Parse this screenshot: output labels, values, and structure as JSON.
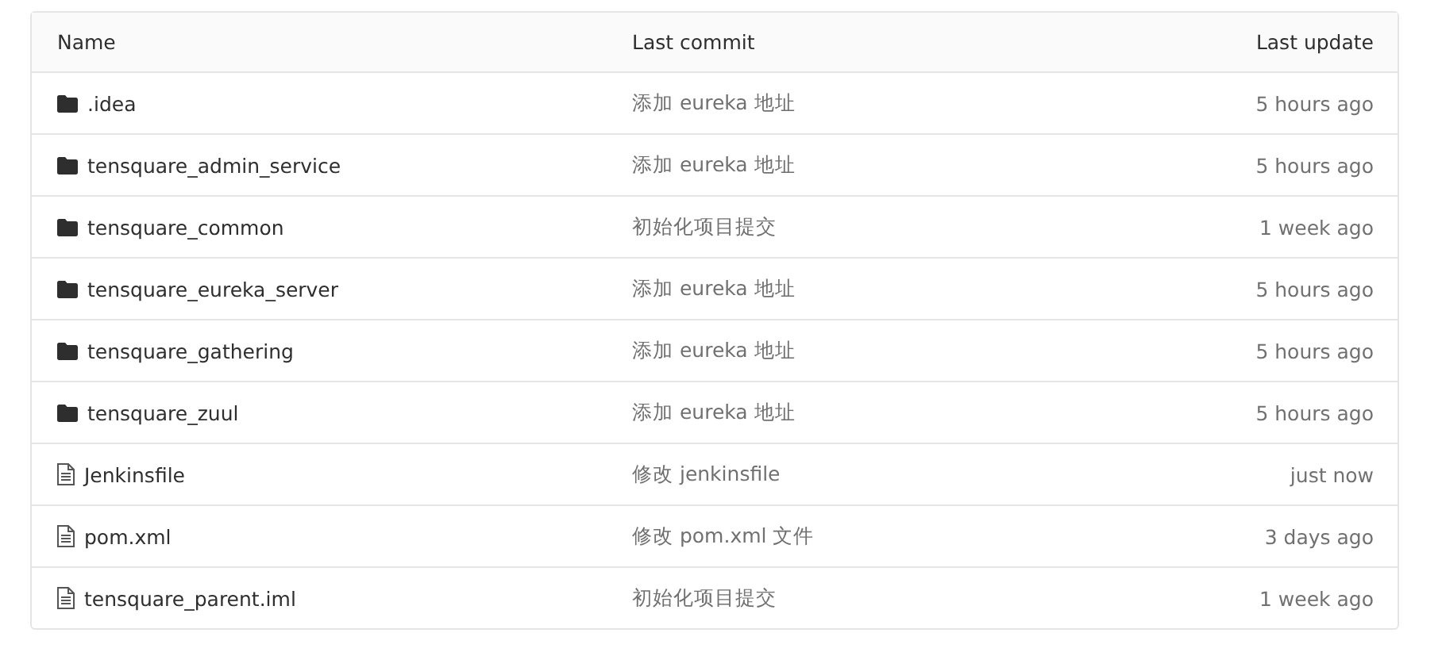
{
  "table": {
    "columns": [
      "Name",
      "Last commit",
      "Last update"
    ],
    "rows": [
      {
        "kind": "folder",
        "name": ".idea",
        "commit": "添加 eureka 地址",
        "updated": "5 hours ago"
      },
      {
        "kind": "folder",
        "name": "tensquare_admin_service",
        "commit": "添加 eureka 地址",
        "updated": "5 hours ago"
      },
      {
        "kind": "folder",
        "name": "tensquare_common",
        "commit": "初始化项目提交",
        "updated": "1 week ago"
      },
      {
        "kind": "folder",
        "name": "tensquare_eureka_server",
        "commit": "添加 eureka 地址",
        "updated": "5 hours ago"
      },
      {
        "kind": "folder",
        "name": "tensquare_gathering",
        "commit": "添加 eureka 地址",
        "updated": "5 hours ago"
      },
      {
        "kind": "folder",
        "name": "tensquare_zuul",
        "commit": "添加 eureka 地址",
        "updated": "5 hours ago"
      },
      {
        "kind": "file",
        "name": "Jenkinsfile",
        "commit": "修改 jenkinsfile",
        "updated": "just now"
      },
      {
        "kind": "file",
        "name": "pom.xml",
        "commit": "修改 pom.xml 文件",
        "updated": "3 days ago"
      },
      {
        "kind": "file",
        "name": "tensquare_parent.iml",
        "commit": "初始化项目提交",
        "updated": "1 week ago"
      }
    ]
  }
}
